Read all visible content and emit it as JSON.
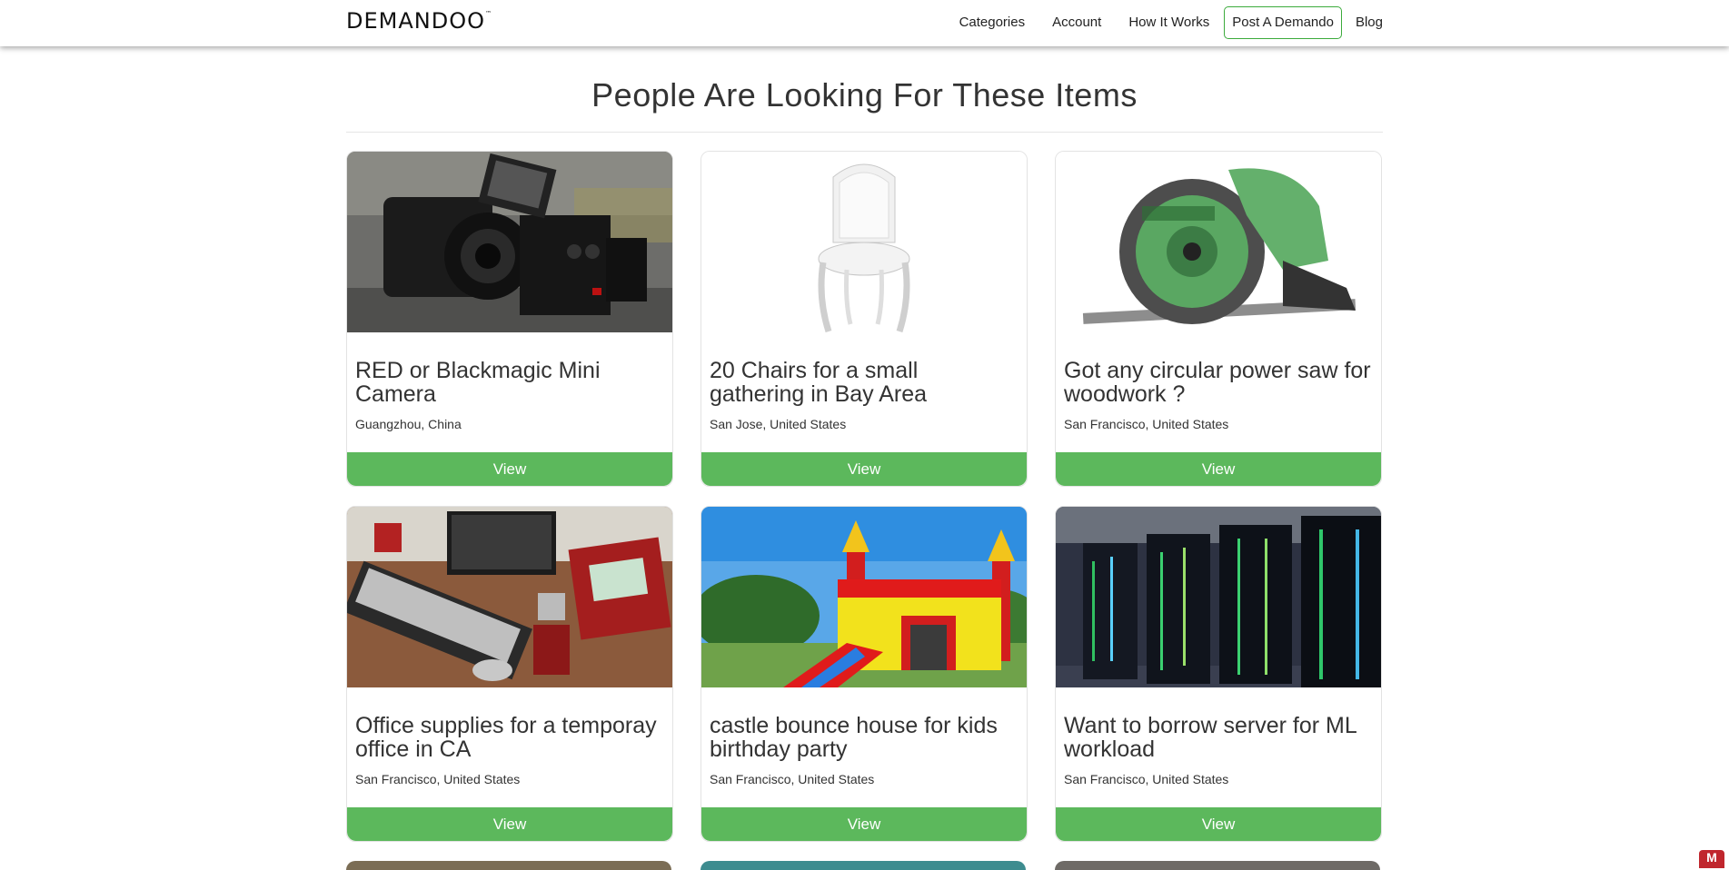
{
  "brand": {
    "logo": "DEMANDOO",
    "tm": "™"
  },
  "nav": {
    "categories": "Categories",
    "account": "Account",
    "how_it_works": "How It Works",
    "post": "Post A Demando",
    "blog": "Blog"
  },
  "heading": "People Are Looking For These Items",
  "cards": [
    {
      "title": "RED or Blackmagic Mini Camera",
      "location": "Guangzhou, China",
      "button": "View",
      "image": "cinema-camera"
    },
    {
      "title": "20 Chairs for a small gathering in Bay Area",
      "location": "San Jose, United States",
      "button": "View",
      "image": "white-chair"
    },
    {
      "title": "Got any circular power saw for woodwork ?",
      "location": "San Francisco, United States",
      "button": "View",
      "image": "circular-saw"
    },
    {
      "title": "Office supplies for a temporay office in CA",
      "location": "San Francisco, United States",
      "button": "View",
      "image": "office-desk"
    },
    {
      "title": "castle bounce house for kids birthday party",
      "location": "San Francisco, United States",
      "button": "View",
      "image": "bounce-house"
    },
    {
      "title": "Want to borrow server for ML workload",
      "location": "San Francisco, United States",
      "button": "View",
      "image": "server-racks"
    }
  ],
  "colors": {
    "button_green": "#5cb85c",
    "post_border": "#3cab3c"
  },
  "badge": "M"
}
